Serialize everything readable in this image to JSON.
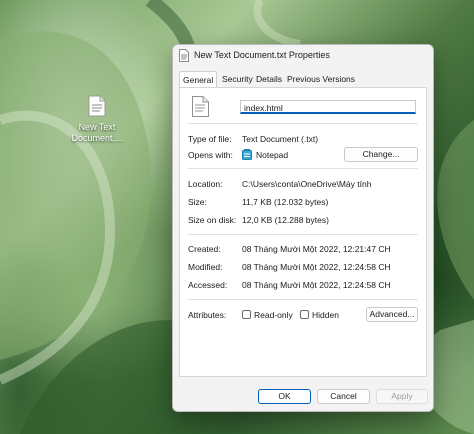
{
  "desktop": {
    "icon_label_line1": "New Text",
    "icon_label_line2": "Document...."
  },
  "dialog": {
    "title": "New Text Document.txt Properties",
    "tabs": [
      {
        "label": "General",
        "active": true
      },
      {
        "label": "Security",
        "active": false
      },
      {
        "label": "Security",
        "active": false
      },
      {
        "label": "Details",
        "active": false
      },
      {
        "label": "Previous Versions",
        "active": false
      }
    ],
    "filename_value": "index.html",
    "type_label": "Type of file:",
    "type_value": "Text Document (.txt)",
    "opens_label": "Opens with:",
    "opens_value": "Notepad",
    "change_button": "Change...",
    "location_label": "Location:",
    "location_value": "C:\\Users\\conta\\OneDrive\\Máy tính",
    "size_label": "Size:",
    "size_value": "11,7 KB (12.032 bytes)",
    "size_disk_label": "Size on disk:",
    "size_disk_value": "12,0 KB (12.288 bytes)",
    "created_label": "Created:",
    "created_value": "08 Tháng Mười Một 2022, 12:21:47 CH",
    "modified_label": "Modified:",
    "modified_value": "08 Tháng Mười Một 2022, 12:24:58 CH",
    "accessed_label": "Accessed:",
    "accessed_value": "08 Tháng Mười Một 2022, 12:24:58 CH",
    "attributes_label": "Attributes:",
    "readonly_label": "Read-only",
    "readonly_checked": false,
    "hidden_label": "Hidden",
    "hidden_checked": false,
    "advanced_button": "Advanced...",
    "ok_button": "OK",
    "cancel_button": "Cancel",
    "apply_button": "Apply"
  },
  "colors": {
    "accent": "#005fb8",
    "dialog_bg": "#f3f3f3",
    "panel_bg": "#ffffff"
  },
  "icons": [
    "text-document-icon",
    "notepad-icon"
  ]
}
